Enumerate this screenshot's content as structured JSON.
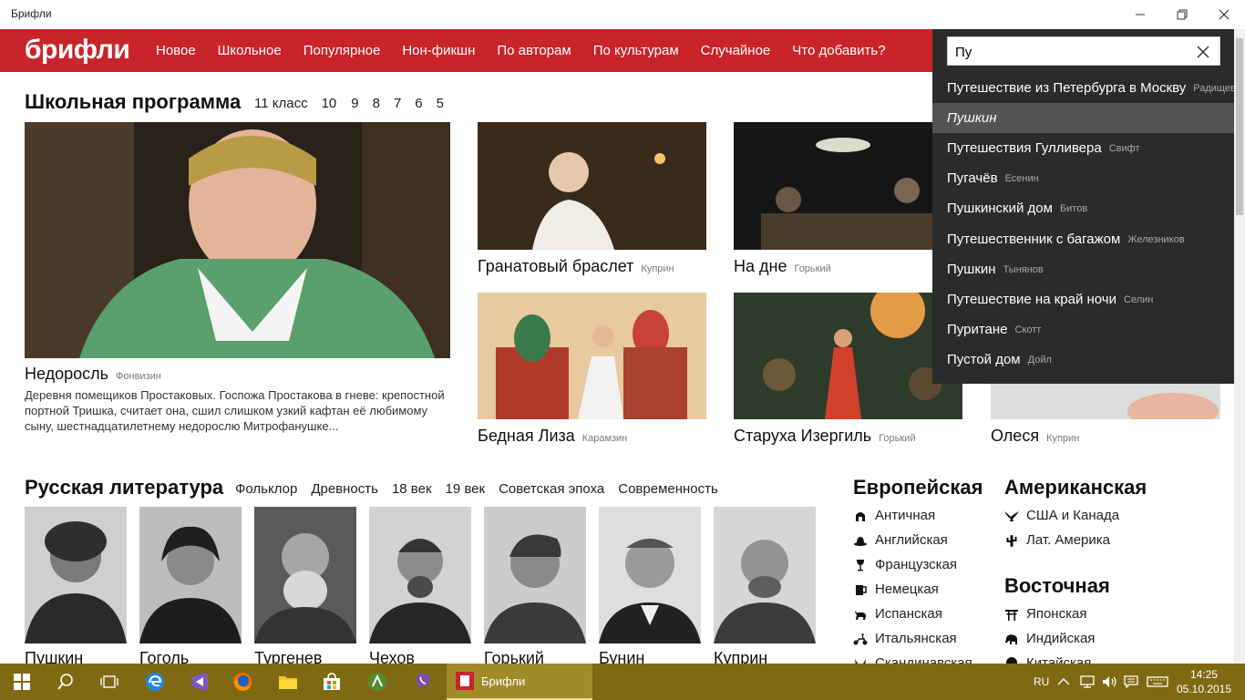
{
  "window": {
    "title": "Брифли"
  },
  "header": {
    "logo": "брифли",
    "nav": [
      "Новое",
      "Школьное",
      "Популярное",
      "Нон-фикшн",
      "По авторам",
      "По культурам",
      "Случайное",
      "Что добавить?"
    ]
  },
  "school": {
    "title": "Школьная программа",
    "filters": [
      "11 класс",
      "10",
      "9",
      "8",
      "7",
      "6",
      "5"
    ],
    "featured": {
      "title": "Недоросль",
      "author": "Фонвизин",
      "description": "Деревня помещиков Простаковых. Госпожа Простакова в гневе: крепостной портной Тришка, считает она, сшил слишком узкий кафтан её любимому сыну, шестнадцатилетнему недорослю Митрофанушке..."
    },
    "tiles": [
      {
        "title": "Гранатовый браслет",
        "author": "Куприн"
      },
      {
        "title": "На дне",
        "author": "Горький"
      },
      {
        "title": "Бедная Лиза",
        "author": "Карамзин"
      },
      {
        "title": "Старуха Изергиль",
        "author": "Горький"
      },
      {
        "title": "Олеся",
        "author": "Куприн"
      }
    ]
  },
  "russian": {
    "title": "Русская литература",
    "filters": [
      "Фольклор",
      "Древность",
      "18 век",
      "19 век",
      "Советская эпоха",
      "Современность"
    ],
    "authors": [
      "Пушкин",
      "Гоголь",
      "Тургенев",
      "Чехов",
      "Горький",
      "Бунин",
      "Куприн"
    ]
  },
  "cultures": {
    "european": {
      "title": "Европейская",
      "items": [
        {
          "label": "Античная",
          "icon": "helmet-icon"
        },
        {
          "label": "Английская",
          "icon": "bowler-hat-icon"
        },
        {
          "label": "Французская",
          "icon": "wine-glass-icon"
        },
        {
          "label": "Немецкая",
          "icon": "beer-mug-icon"
        },
        {
          "label": "Испанская",
          "icon": "bull-icon"
        },
        {
          "label": "Итальянская",
          "icon": "scooter-icon"
        },
        {
          "label": "Скандинавская",
          "icon": "viking-helmet-icon"
        }
      ]
    },
    "american": {
      "title": "Американская",
      "items": [
        {
          "label": "США и Канада",
          "icon": "eagle-icon"
        },
        {
          "label": "Лат. Америка",
          "icon": "cactus-icon"
        }
      ]
    },
    "eastern": {
      "title": "Восточная",
      "items": [
        {
          "label": "Японская",
          "icon": "torii-icon"
        },
        {
          "label": "Индийская",
          "icon": "elephant-icon"
        },
        {
          "label": "Китайская",
          "icon": "yin-yang-icon"
        }
      ]
    }
  },
  "search": {
    "value": "Пу",
    "suggestions": [
      {
        "title": "Путешествие из Петербурга в Москву",
        "author": "Радищев",
        "active": false
      },
      {
        "title": "Пушкин",
        "author": "",
        "active": true
      },
      {
        "title": "Путешествия Гулливера",
        "author": "Свифт",
        "active": false
      },
      {
        "title": "Пугачёв",
        "author": "Есенин",
        "active": false
      },
      {
        "title": "Пушкинский дом",
        "author": "Битов",
        "active": false
      },
      {
        "title": "Путешественник с багажом",
        "author": "Железников",
        "active": false
      },
      {
        "title": "Пушкин",
        "author": "Тынянов",
        "active": false
      },
      {
        "title": "Путешествие на край ночи",
        "author": "Селин",
        "active": false
      },
      {
        "title": "Пуритане",
        "author": "Скотт",
        "active": false
      },
      {
        "title": "Пустой дом",
        "author": "Дойл",
        "active": false
      }
    ]
  },
  "taskbar": {
    "active_app": "Брифли",
    "language": "RU",
    "time": "14:25",
    "date": "05.10.2015",
    "pinned_icons": [
      "windows-start-icon",
      "search-icon",
      "task-view-icon",
      "edge-icon",
      "visual-studio-icon",
      "firefox-icon",
      "file-explorer-icon",
      "store-icon",
      "android-studio-icon",
      "viber-icon"
    ]
  },
  "colors": {
    "brand_red": "#c9242b",
    "taskbar": "#7f6a13",
    "dropdown": "#2b2b2b"
  }
}
